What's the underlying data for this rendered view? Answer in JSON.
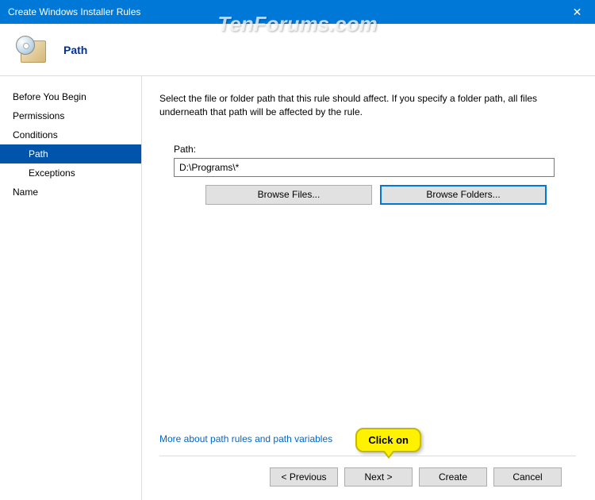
{
  "window": {
    "title": "Create Windows Installer Rules",
    "close_label": "✕"
  },
  "watermark": "TenForums.com",
  "header": {
    "title": "Path"
  },
  "sidebar": {
    "steps": [
      {
        "label": "Before You Begin",
        "type": "step"
      },
      {
        "label": "Permissions",
        "type": "step"
      },
      {
        "label": "Conditions",
        "type": "step"
      },
      {
        "label": "Path",
        "type": "substep",
        "selected": true
      },
      {
        "label": "Exceptions",
        "type": "substep"
      },
      {
        "label": "Name",
        "type": "step"
      }
    ]
  },
  "main": {
    "instruction": "Select the file or folder path that this rule should affect. If you specify a folder path, all files underneath that path will be affected by the rule.",
    "path_label": "Path:",
    "path_value": "D:\\Programs\\*",
    "browse_files_label": "Browse Files...",
    "browse_folders_label": "Browse Folders...",
    "help_link": "More about path rules and path variables"
  },
  "footer": {
    "previous_label": "< Previous",
    "next_label": "Next >",
    "create_label": "Create",
    "cancel_label": "Cancel"
  },
  "callout": {
    "text": "Click on"
  }
}
